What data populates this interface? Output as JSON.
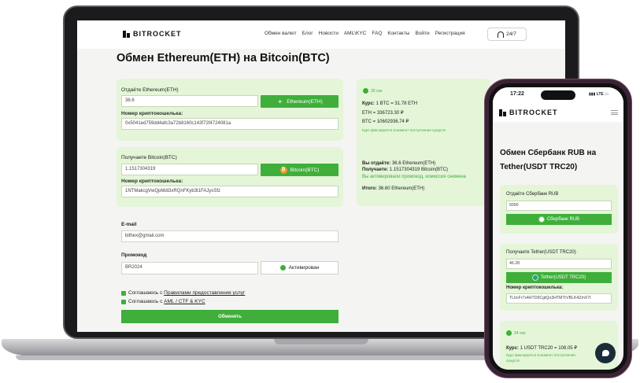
{
  "site": {
    "logo": "BITROCKET",
    "nav": [
      "Обмен валют",
      "Блог",
      "Новости",
      "AML\\KYC",
      "FAQ",
      "Контакты",
      "Войти",
      "Регистрация"
    ],
    "support": "24/7"
  },
  "exchange": {
    "title": "Обмен Ethereum(ETH) на Bitcoin(BTC)",
    "give": {
      "label": "Отдаёте Ethereum(ETH)",
      "amount": "36.6",
      "currency": "Ethereum(ETH)",
      "wallet_label": "Номер криптокошелька:",
      "wallet": "0x5041ed759dd4afc3a72b8160c143f72f4724081a"
    },
    "get": {
      "label": "Получаете Bitcoin(BTC)",
      "amount": "1.1517304319",
      "currency": "Bitcoin(BTC)",
      "wallet_label": "Номер криптокошелька:",
      "wallet": "1NTMakcgVwQpMdi3xRQnFKyb3t1FAJysSfz"
    },
    "email": {
      "label": "E-mail",
      "value": "bithex@gmail.com"
    },
    "promo": {
      "label": "Промокод",
      "value": "BR2024",
      "status": "Активирован"
    },
    "agree1_prefix": "Соглашаюсь с ",
    "agree1_link": "Правилами предоставления услуг",
    "agree2_prefix": "Соглашаюсь с ",
    "agree2_link": "AML / CTF & KYC",
    "submit": "Обменять"
  },
  "summary": {
    "timer": "30 сек",
    "rate_label": "Курс:",
    "rate": "1 BTC = 31.78 ETH",
    "eth_rub": "ETH = 336723.30 ₽",
    "btc_rub": "BTC = 10602936.74 ₽",
    "rate_note": "Курс фиксируется в момент поступления средств",
    "you_give_label": "Вы отдаёте:",
    "you_give": "36.6 Ethereum(ETH)",
    "you_get_label": "Получаете:",
    "you_get": "1.1517304319 Bitcoin(BTC)",
    "promo_note": "Вы активировали промокод, комиссия снижена",
    "total_label": "Итого:",
    "total": "36.60 Ethereum(ETH)"
  },
  "phone": {
    "time": "17:22",
    "status": "LTE",
    "title": "Обмен Сбербанк RUB на Tether(USDT TRC20)",
    "give_label": "Отдаёте Сбербанк RUB",
    "give_amount": "5000",
    "give_currency": "Сбербанк RUB",
    "get_label": "Получаете Tether(USDT TRC20)",
    "get_amount": "46.28",
    "get_currency": "Tether(USDT TRC20)",
    "wallet_label": "Номер криптокошелька:",
    "wallet": "TLbcFr7x4HTD9CgtQo3HTMTrVBLK4ZmX7I",
    "timer": "24 сек",
    "rate_label": "Курс:",
    "rate": "1 USDT TRC20 = 108.05 ₽",
    "rate_note": "Курс фиксируется в момент поступления средств"
  },
  "colors": {
    "accent": "#3fae3b",
    "panel": "#e4f5d8",
    "page": "#f4f5f2"
  }
}
